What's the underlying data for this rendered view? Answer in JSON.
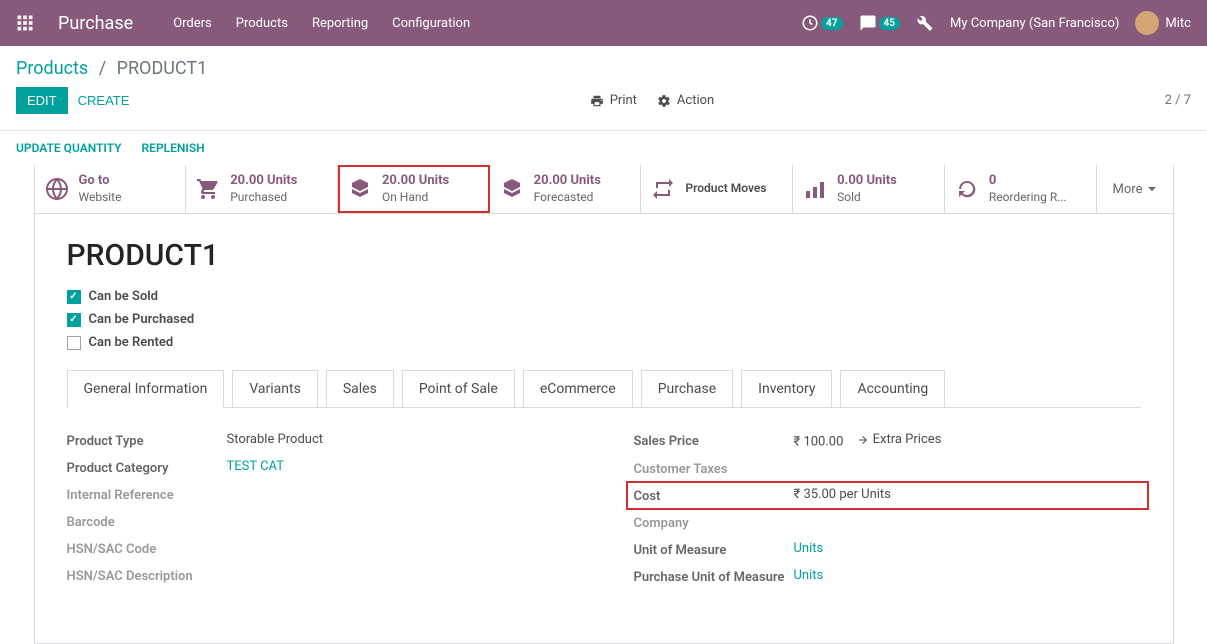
{
  "navbar": {
    "brand": "Purchase",
    "menu": [
      "Orders",
      "Products",
      "Reporting",
      "Configuration"
    ],
    "activity_count": "47",
    "message_count": "45",
    "company": "My Company (San Francisco)",
    "user": "Mitc"
  },
  "breadcrumb": {
    "parent": "Products",
    "current": "PRODUCT1"
  },
  "controls": {
    "edit": "Edit",
    "create": "Create",
    "print": "Print",
    "action": "Action",
    "pager": "2 / 7"
  },
  "secondary": {
    "update_qty": "Update Quantity",
    "replenish": "Replenish"
  },
  "stats": {
    "go_to_website": {
      "value": "Go to",
      "label": "Website"
    },
    "purchased": {
      "value": "20.00 Units",
      "label": "Purchased"
    },
    "on_hand": {
      "value": "20.00 Units",
      "label": "On Hand"
    },
    "forecasted": {
      "value": "20.00 Units",
      "label": "Forecasted"
    },
    "moves": {
      "value": "",
      "label": "Product Moves"
    },
    "sold": {
      "value": "0.00 Units",
      "label": "Sold"
    },
    "reordering": {
      "value": "0",
      "label": "Reordering R..."
    },
    "more": "More"
  },
  "product": {
    "name": "PRODUCT1",
    "can_be_sold_label": "Can be Sold",
    "can_be_purchased_label": "Can be Purchased",
    "can_be_rented_label": "Can be Rented"
  },
  "tabs": [
    "General Information",
    "Variants",
    "Sales",
    "Point of Sale",
    "eCommerce",
    "Purchase",
    "Inventory",
    "Accounting"
  ],
  "fields_left": {
    "product_type": {
      "label": "Product Type",
      "value": "Storable Product"
    },
    "product_category": {
      "label": "Product Category",
      "value": "TEST CAT"
    },
    "internal_reference": {
      "label": "Internal Reference",
      "value": ""
    },
    "barcode": {
      "label": "Barcode",
      "value": ""
    },
    "hsn_code": {
      "label": "HSN/SAC Code",
      "value": ""
    },
    "hsn_desc": {
      "label": "HSN/SAC Description",
      "value": ""
    }
  },
  "fields_right": {
    "sales_price": {
      "label": "Sales Price",
      "value": "₹ 100.00",
      "extra": "Extra Prices"
    },
    "customer_taxes": {
      "label": "Customer Taxes",
      "value": ""
    },
    "cost": {
      "label": "Cost",
      "value": "₹ 35.00 per Units"
    },
    "company": {
      "label": "Company",
      "value": ""
    },
    "uom": {
      "label": "Unit of Measure",
      "value": "Units"
    },
    "purchase_uom": {
      "label": "Purchase Unit of Measure",
      "value": "Units"
    }
  }
}
